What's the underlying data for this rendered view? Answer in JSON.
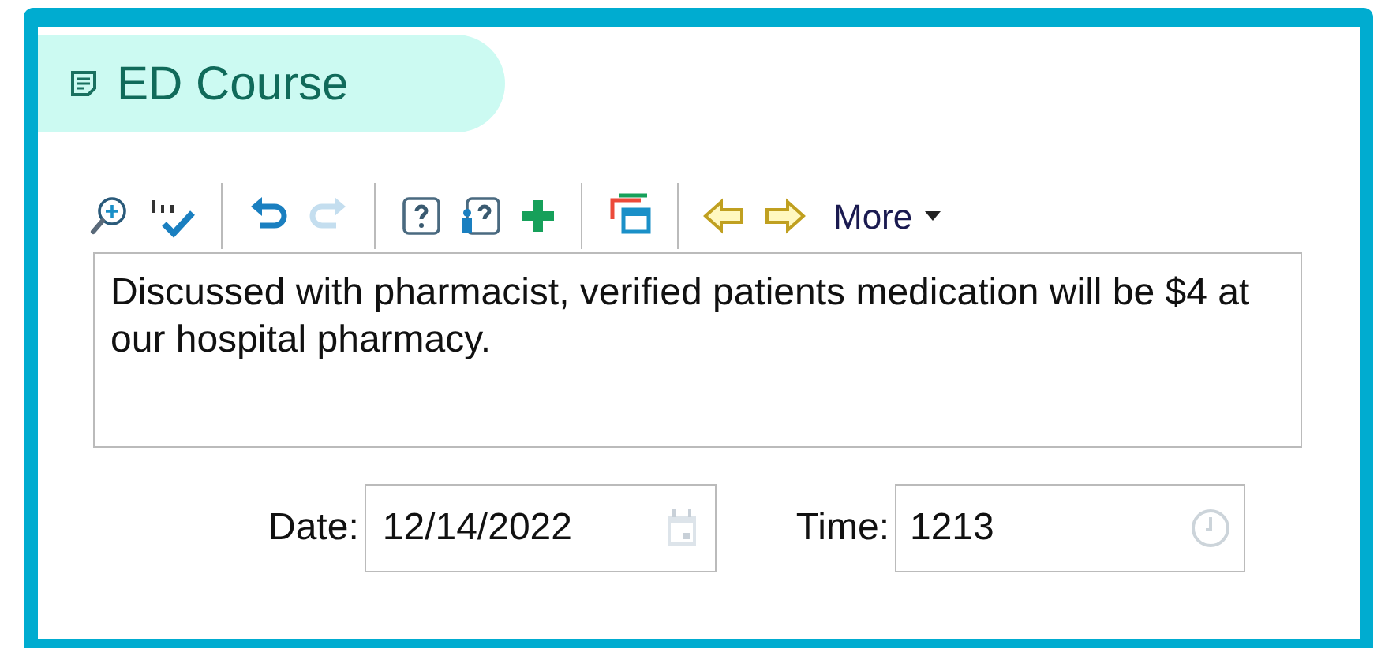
{
  "section": {
    "title": "ED Course"
  },
  "toolbar": [
    {
      "kind": "zoom",
      "disabled": false
    },
    {
      "kind": "spell",
      "disabled": false
    },
    {
      "kind": "sep"
    },
    {
      "kind": "undo",
      "disabled": false
    },
    {
      "kind": "redo",
      "disabled": true
    },
    {
      "kind": "sep"
    },
    {
      "kind": "help",
      "disabled": false
    },
    {
      "kind": "helpuser",
      "disabled": false
    },
    {
      "kind": "add",
      "disabled": false
    },
    {
      "kind": "sep"
    },
    {
      "kind": "windows",
      "disabled": false
    },
    {
      "kind": "sep"
    },
    {
      "kind": "back",
      "disabled": false
    },
    {
      "kind": "forward",
      "disabled": false
    },
    {
      "kind": "more",
      "label": "More"
    }
  ],
  "note": {
    "value": "Discussed with pharmacist, verified patients medication will be $4 at our hospital pharmacy."
  },
  "date": {
    "label": "Date:",
    "value": "12/14/2022"
  },
  "time": {
    "label": "Time:",
    "value": "1213"
  }
}
